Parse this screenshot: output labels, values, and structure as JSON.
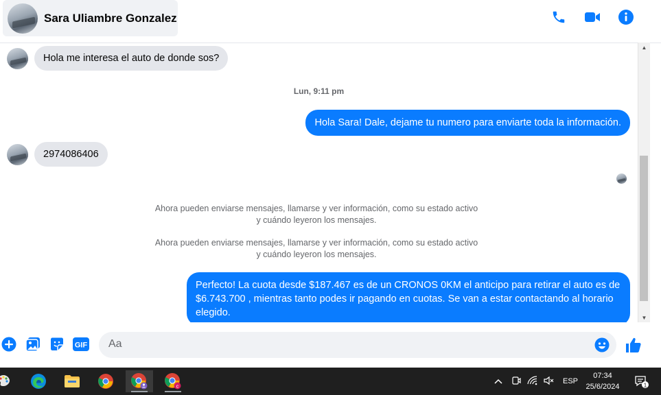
{
  "header": {
    "contact_name": "Sara Uliambre Gonzalez",
    "actions": [
      {
        "name": "phone-call-icon"
      },
      {
        "name": "video-call-icon"
      },
      {
        "name": "info-icon"
      }
    ],
    "accent_color": "#0a7cff"
  },
  "messages": {
    "in_1": "Hola me interesa el auto de donde sos?",
    "timestamp_1": "Lun, 9:11 pm",
    "out_1": "Hola Sara! Dale, dejame tu numero  para enviarte toda la información.",
    "in_2": "2974086406",
    "system_1": "Ahora pueden enviarse mensajes, llamarse y ver información, como su estado activo y cuándo leyeron los mensajes.",
    "system_2": "Ahora pueden enviarse mensajes, llamarse y ver información, como su estado activo y cuándo leyeron los mensajes.",
    "out_2": "Perfecto! La cuota desde $187.467 es de un CRONOS 0KM el anticipo para retirar el auto es de $6.743.700 , mientras tanto podes ir pagando en cuotas. Se van a estar contactando al horario elegido."
  },
  "composer": {
    "placeholder": "Aa",
    "value": "",
    "gif_label": "GIF"
  },
  "taskbar": {
    "language": "ESP",
    "time": "07:34",
    "date": "25/6/2024",
    "notification_count": "1"
  }
}
